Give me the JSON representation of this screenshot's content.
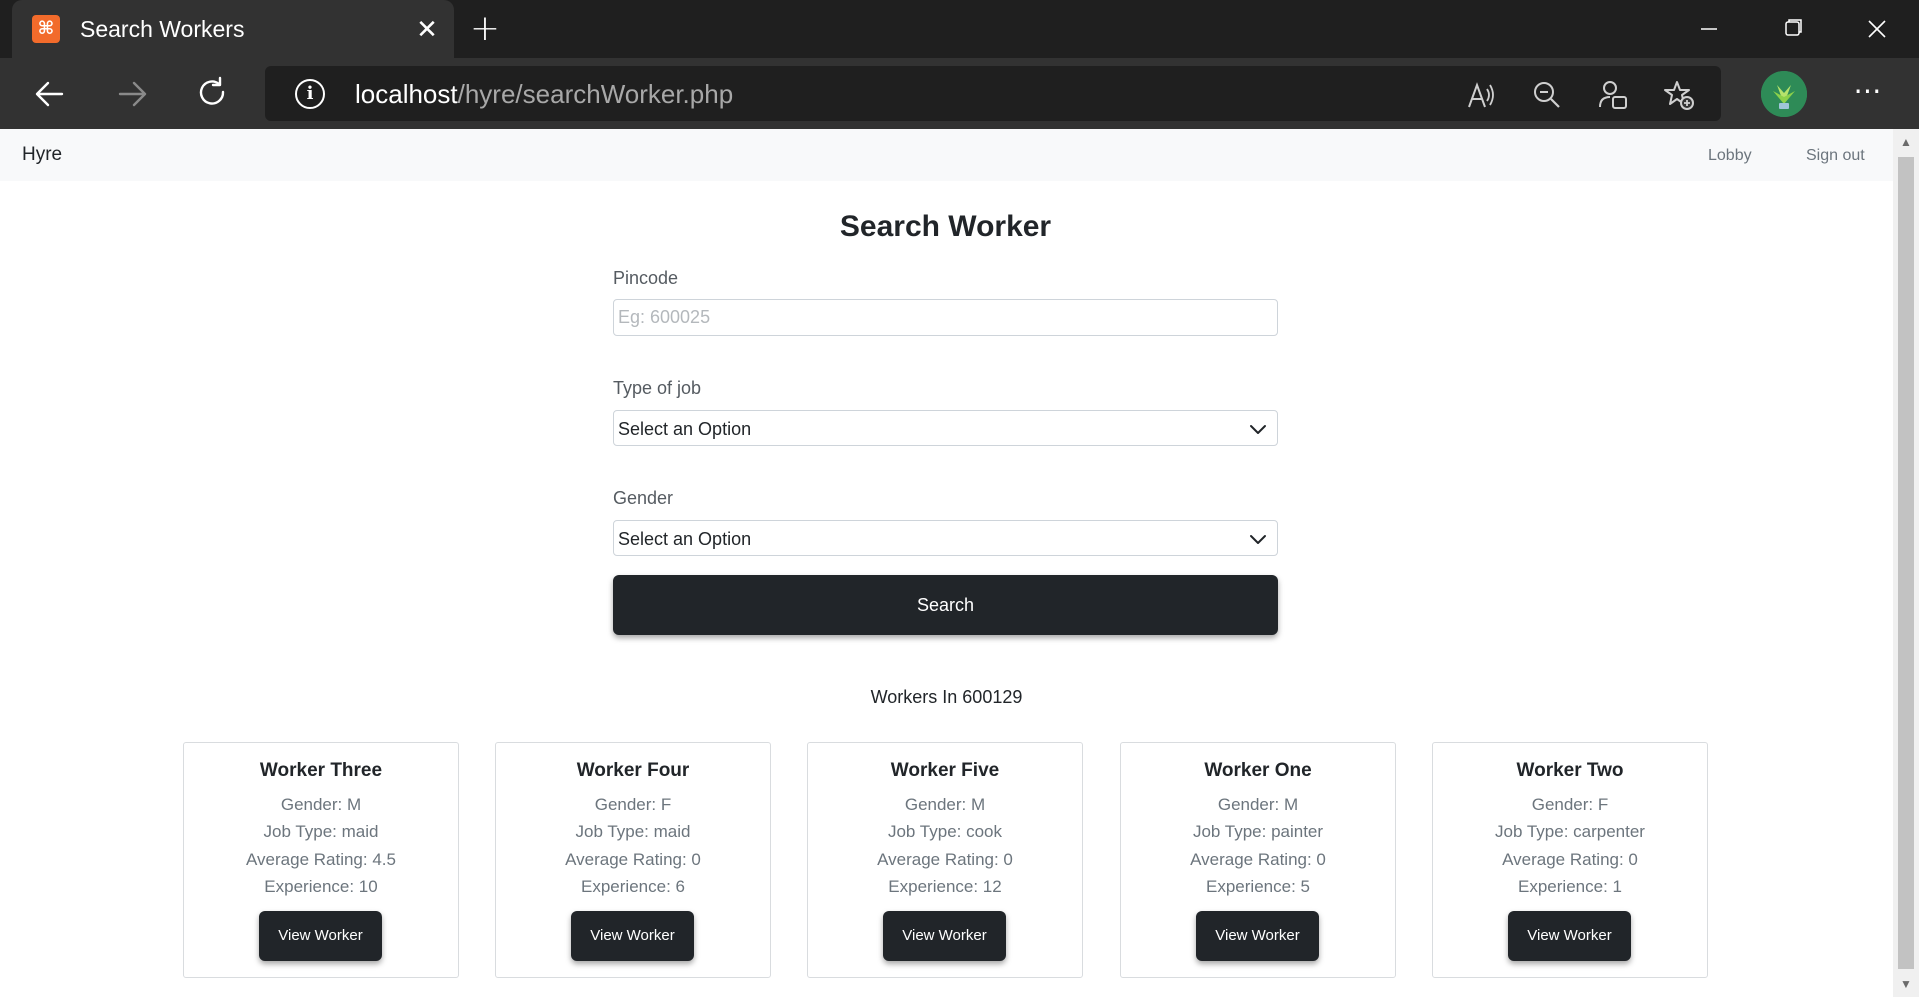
{
  "browser": {
    "tab_title": "Search Workers",
    "url_host": "localhost",
    "url_path": "/hyre/searchWorker.php"
  },
  "navbar": {
    "brand": "Hyre",
    "links": [
      "Lobby",
      "Sign out"
    ]
  },
  "form": {
    "title": "Search Worker",
    "pincode_label": "Pincode",
    "pincode_placeholder": "Eg: 600025",
    "job_label": "Type of job",
    "job_value": "Select an Option",
    "gender_label": "Gender",
    "gender_value": "Select an Option",
    "search_label": "Search"
  },
  "results": {
    "heading": "Workers In 600129",
    "view_label": "View Worker",
    "workers": [
      {
        "name": "Worker Three",
        "gender": "Gender: M",
        "job": "Job Type: maid",
        "rating": "Average Rating: 4.5",
        "experience": "Experience: 10"
      },
      {
        "name": "Worker Four",
        "gender": "Gender: F",
        "job": "Job Type: maid",
        "rating": "Average Rating: 0",
        "experience": "Experience: 6"
      },
      {
        "name": "Worker Five",
        "gender": "Gender: M",
        "job": "Job Type: cook",
        "rating": "Average Rating: 0",
        "experience": "Experience: 12"
      },
      {
        "name": "Worker One",
        "gender": "Gender: M",
        "job": "Job Type: painter",
        "rating": "Average Rating: 0",
        "experience": "Experience: 5"
      },
      {
        "name": "Worker Two",
        "gender": "Gender: F",
        "job": "Job Type: carpenter",
        "rating": "Average Rating: 0",
        "experience": "Experience: 1"
      }
    ]
  },
  "colors": {
    "primary_button": "#212529",
    "navbar_bg": "#f8f9fa",
    "browser_chrome": "#323232",
    "favicon": "#f26b2b"
  },
  "icons": {
    "favicon": "xampp-icon",
    "tab_close": "close-icon",
    "new_tab": "plus-icon",
    "back": "back-arrow-icon",
    "forward": "forward-arrow-icon",
    "reload": "reload-icon",
    "site_info": "info-icon",
    "read_aloud": "read-aloud-icon",
    "zoom": "zoom-out-icon",
    "profile_tools": "profile-icon",
    "favorites": "add-favorite-icon",
    "more": "more-icon"
  }
}
